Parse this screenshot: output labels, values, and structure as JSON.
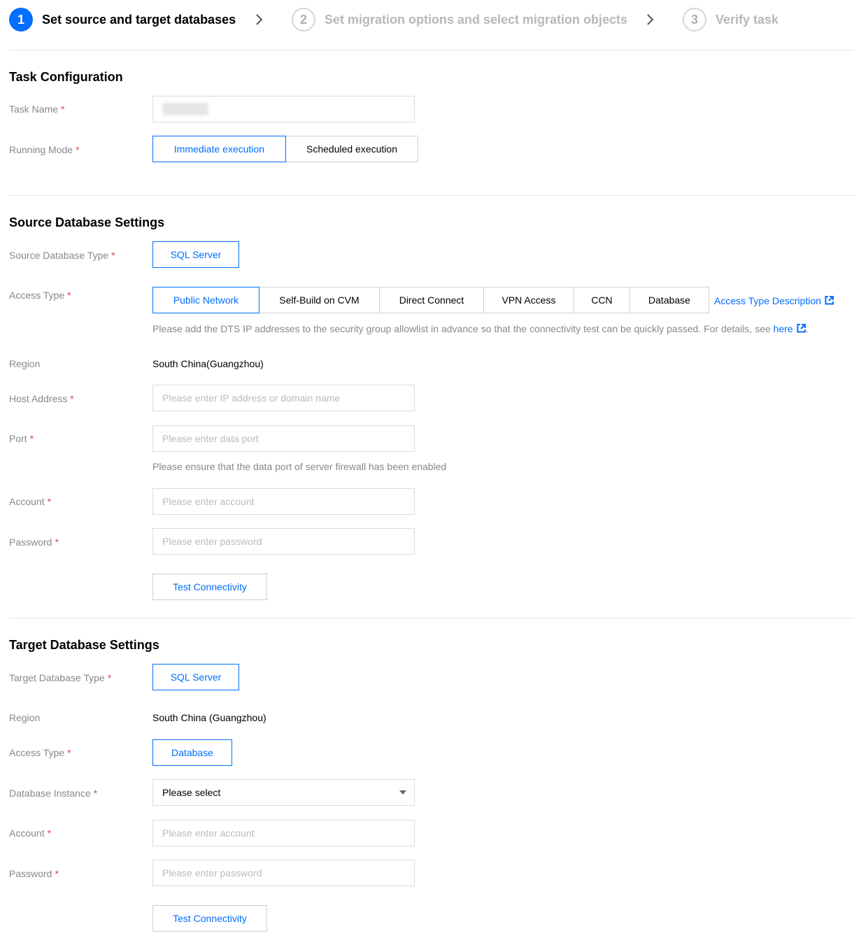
{
  "steps": [
    {
      "number": "1",
      "label": "Set source and target databases",
      "state": "active"
    },
    {
      "number": "2",
      "label": "Set migration options and select migration objects",
      "state": "inactive"
    },
    {
      "number": "3",
      "label": "Verify task",
      "state": "inactive"
    }
  ],
  "task_config": {
    "title": "Task Configuration",
    "task_name_label": "Task Name",
    "running_mode_label": "Running Mode",
    "running_modes": [
      "Immediate execution",
      "Scheduled execution"
    ],
    "selected_mode": "Immediate execution"
  },
  "source": {
    "title": "Source Database Settings",
    "db_type_label": "Source Database Type",
    "db_type": "SQL Server",
    "access_type_label": "Access Type",
    "access_types": [
      "Public Network",
      "Self-Build on CVM",
      "Direct Connect",
      "VPN Access",
      "CCN",
      "Database"
    ],
    "selected_access_type": "Public Network",
    "access_desc_link": "Access Type Description",
    "allowlist_hint": "Please add the DTS IP addresses to the security group allowlist in advance so that the connectivity test can be quickly passed. For details, see",
    "allowlist_link": "here",
    "hint_suffix": ".",
    "region_label": "Region",
    "region": "South China(Guangzhou)",
    "host_label": "Host Address",
    "host_placeholder": "Please enter IP address or domain name",
    "port_label": "Port",
    "port_placeholder": "Please enter data port",
    "port_hint": "Please ensure that the data port of server firewall has been enabled",
    "account_label": "Account",
    "account_placeholder": "Please enter account",
    "password_label": "Password",
    "password_placeholder": "Please enter password",
    "test_button": "Test Connectivity"
  },
  "target": {
    "title": "Target Database Settings",
    "db_type_label": "Target Database Type",
    "db_type": "SQL Server",
    "region_label": "Region",
    "region": "South China (Guangzhou)",
    "access_type_label": "Access Type",
    "access_type": "Database",
    "instance_label": "Database Instance",
    "instance_value": "Please select",
    "account_label": "Account",
    "account_placeholder": "Please enter account",
    "password_label": "Password",
    "password_placeholder": "Please enter password",
    "test_button": "Test Connectivity"
  },
  "required_mark": "*",
  "colors": {
    "accent": "#006eff",
    "required": "#e54545",
    "muted": "#888888",
    "border": "#dcdcdc"
  }
}
